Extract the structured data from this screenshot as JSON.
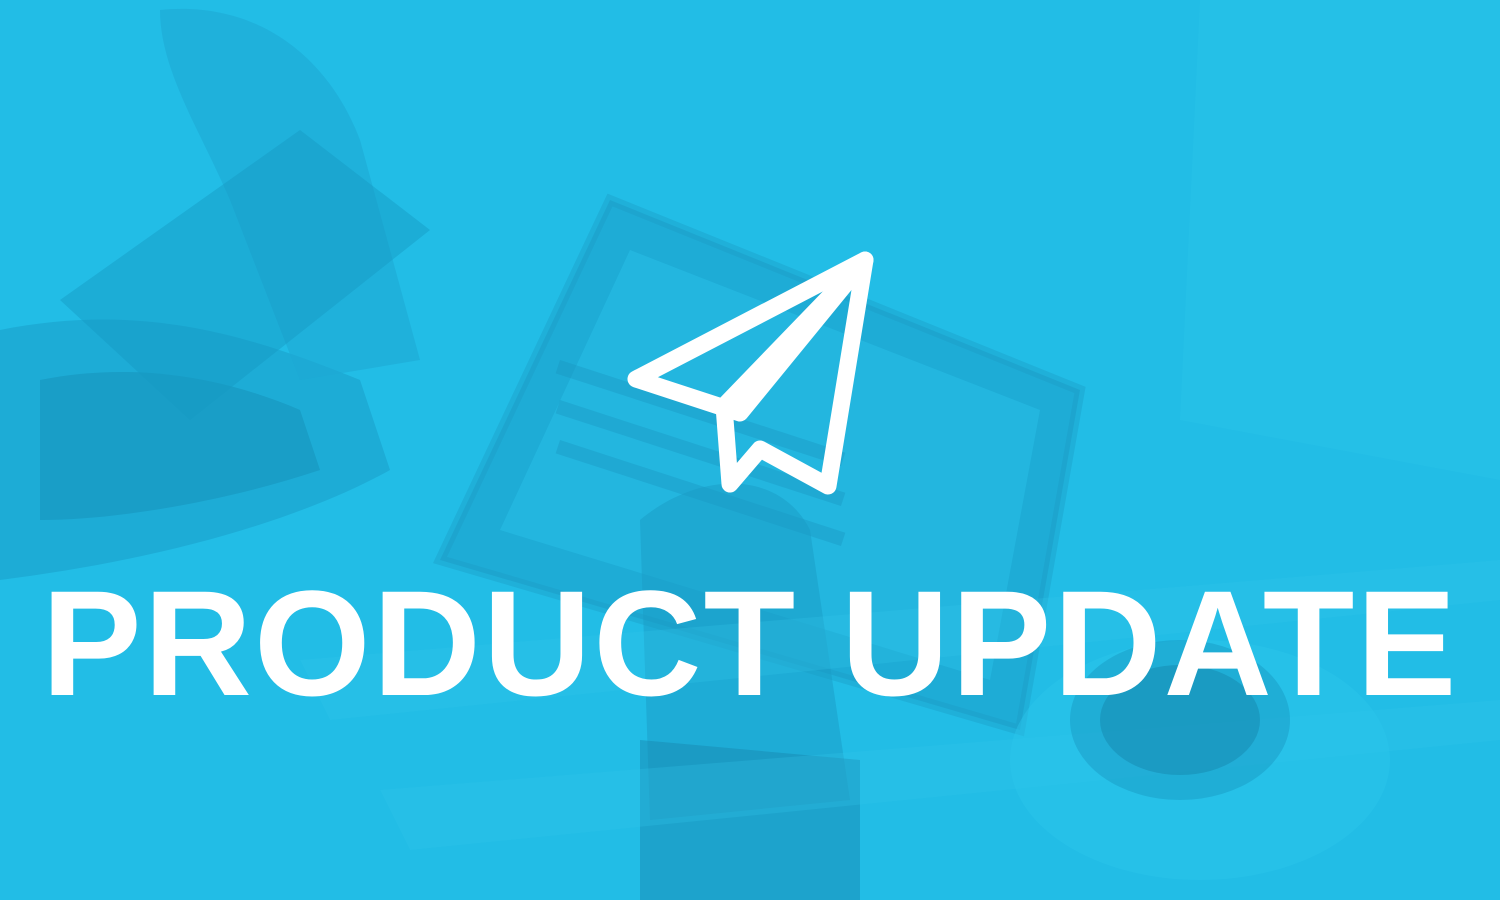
{
  "banner": {
    "headline": "PRODUCT UPDATE",
    "icon": "paper-plane-icon",
    "colors": {
      "background": "#22bde6",
      "text": "#ffffff"
    }
  }
}
